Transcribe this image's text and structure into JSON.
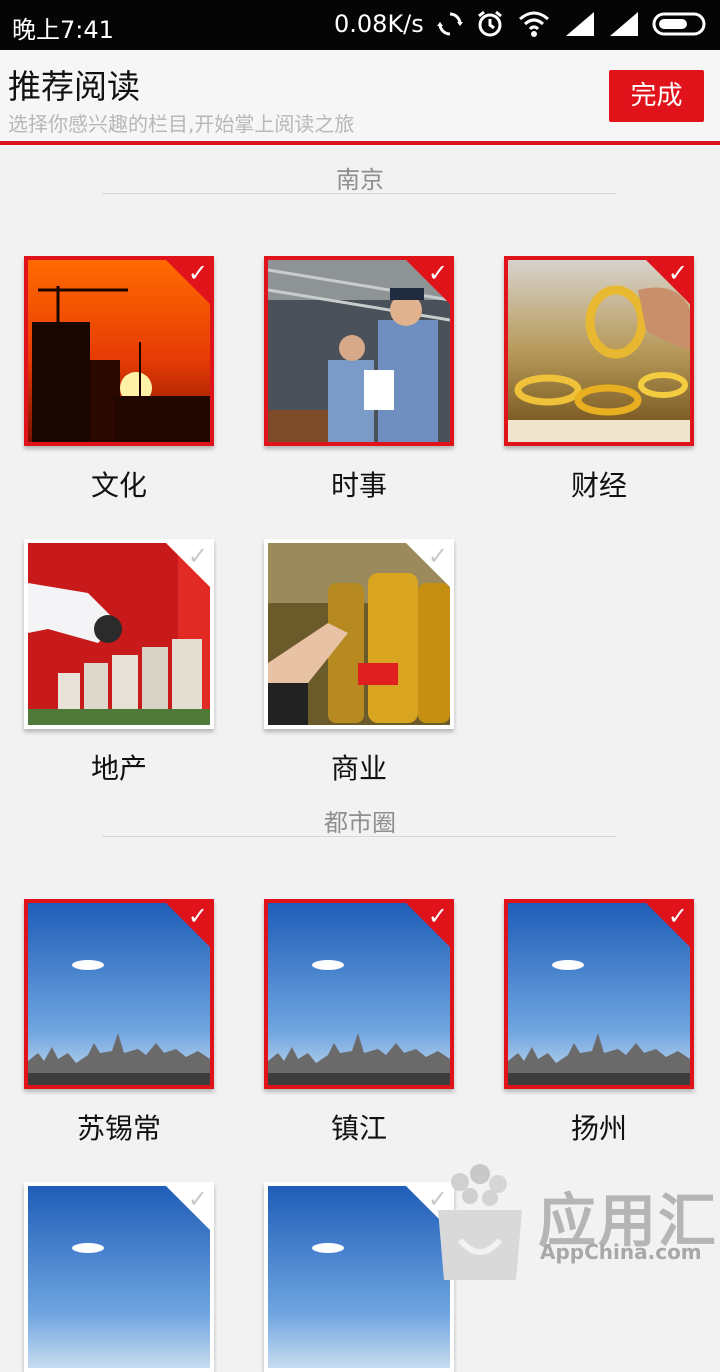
{
  "status_bar": {
    "time": "晚上7:41",
    "network_speed": "0.08K/s",
    "icons": [
      "sync-icon",
      "alarm-icon",
      "wifi-icon",
      "signal-icon",
      "signal-icon",
      "battery-icon"
    ]
  },
  "header": {
    "title": "推荐阅读",
    "subtitle": "选择你感兴趣的栏目,开始掌上阅读之旅",
    "done_label": "完成"
  },
  "colors": {
    "accent": "#e0121a",
    "background": "#f2f2f2"
  },
  "sections": [
    {
      "title": "南京",
      "items": [
        {
          "label": "文化",
          "selected": true
        },
        {
          "label": "时事",
          "selected": true
        },
        {
          "label": "财经",
          "selected": true
        },
        {
          "label": "地产",
          "selected": false
        },
        {
          "label": "商业",
          "selected": false
        }
      ]
    },
    {
      "title": "都市圈",
      "items": [
        {
          "label": "苏锡常",
          "selected": true
        },
        {
          "label": "镇江",
          "selected": true
        },
        {
          "label": "扬州",
          "selected": true
        },
        {
          "label": "",
          "selected": false
        },
        {
          "label": "",
          "selected": false
        }
      ]
    }
  ],
  "watermark": {
    "brand": "应用汇",
    "domain": "AppChina.com"
  }
}
